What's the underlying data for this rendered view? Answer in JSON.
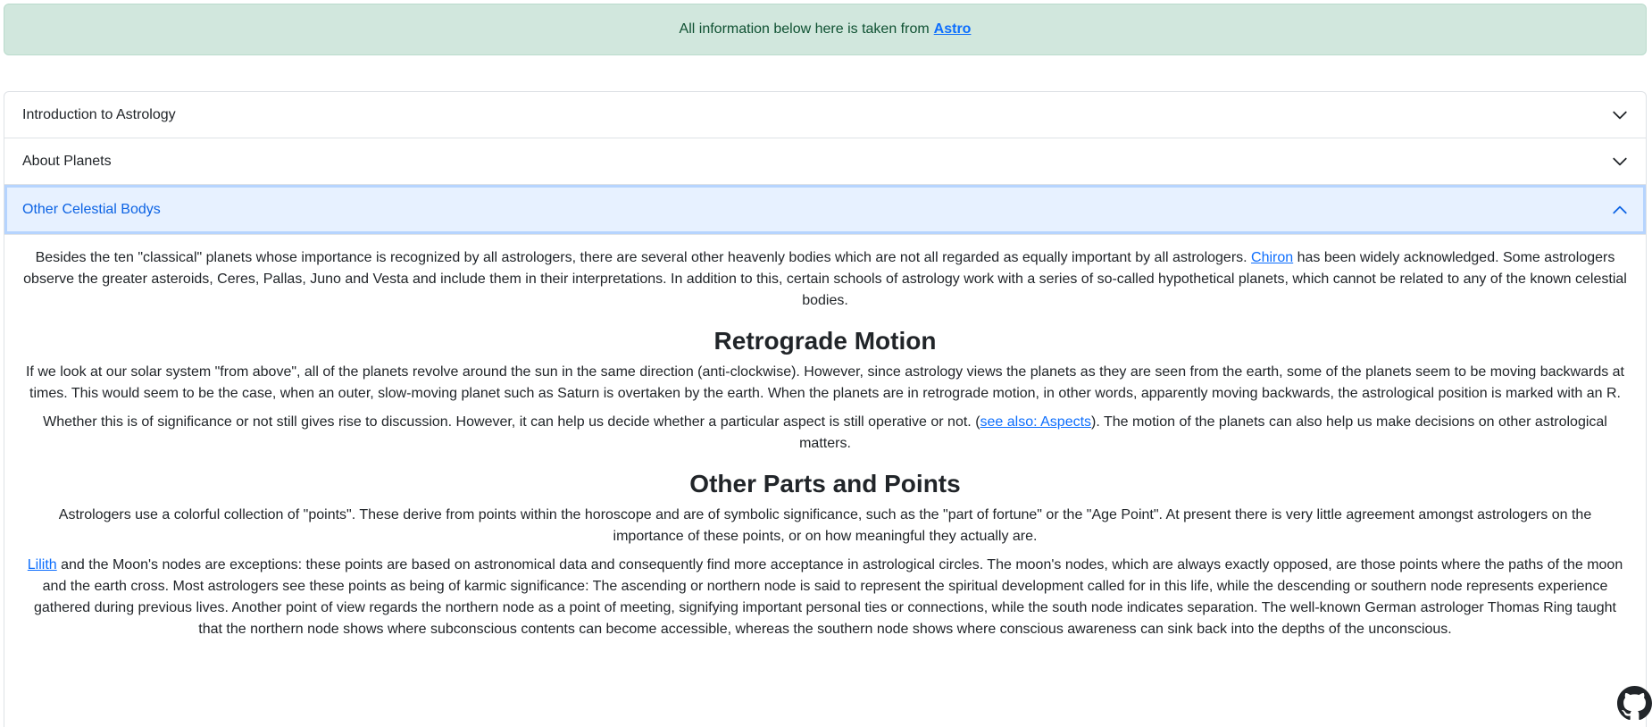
{
  "alert": {
    "text": "All information below here is taken from",
    "link": "Astro"
  },
  "accordion": {
    "items": [
      {
        "label": "Introduction to Astrology"
      },
      {
        "label": "About Planets"
      },
      {
        "label": "Other Celestial Bodys"
      }
    ]
  },
  "content": {
    "p1_a": "Besides the ten \"classical\" planets whose importance is recognized by all astrologers, there are several other heavenly bodies which are not all regarded as equally important by all astrologers. ",
    "p1_link": "Chiron",
    "p1_b": " has been widely acknowledged. Some astrologers observe the greater asteroids, Ceres, Pallas, Juno and Vesta and include them in their interpretations. In addition to this, certain schools of astrology work with a series of so-called hypothetical planets, which cannot be related to any of the known celestial bodies.",
    "h_retro": "Retrograde Motion",
    "p2": "If we look at our solar system \"from above\", all of the planets revolve around the sun in the same direction (anti-clockwise). However, since astrology views the planets as they are seen from the earth, some of the planets seem to be moving backwards at times. This would seem to be the case, when an outer, slow-moving planet such as Saturn is overtaken by the earth. When the planets are in retrograde motion, in other words, apparently moving backwards,  the astrological position is marked with an R.",
    "p3_a": "Whether this is of significance or not still gives rise to discussion. However, it can help us decide whether a particular aspect is still operative or not. (",
    "p3_link": "see also: Aspects",
    "p3_b": ").  The motion of the planets can also help us make decisions on other astrological matters.",
    "h_points": "Other Parts and Points",
    "p4": "Astrologers use a colorful collection of \"points\". These derive from points within the horoscope and are of symbolic significance, such as the \"part of fortune\" or the \"Age Point\". At present there is very little agreement amongst astrologers on the importance of these points, or on how meaningful they actually are.",
    "p5_link": "Lilith",
    "p5_b": " and the Moon's nodes are exceptions: these points are based on astronomical data and consequently find more acceptance in astrological circles. The moon's nodes, which are always exactly opposed, are those points where the paths of the moon and the earth cross. Most astrologers see these points as being of karmic significance: The ascending or northern node is said to represent the spiritual development called for in this life, while the descending or southern node represents experience gathered during previous lives. Another point of view regards the northern node as a point of meeting, signifying important personal ties or connections, while the south node indicates separation. The well-known German astrologer Thomas Ring taught that the northern node shows where subconscious contents can become accessible, whereas the southern node shows where conscious awareness can sink back into the depths of the unconscious."
  },
  "icons": {
    "chevron_down": "chevron-down-icon",
    "chevron_up": "chevron-up-icon",
    "github": "github-icon"
  },
  "colors": {
    "alert_bg": "#d1e7dd",
    "alert_text": "#0f5132",
    "link": "#0d6efd",
    "active_bg": "#e7f1ff",
    "active_text": "#0c63e4"
  }
}
